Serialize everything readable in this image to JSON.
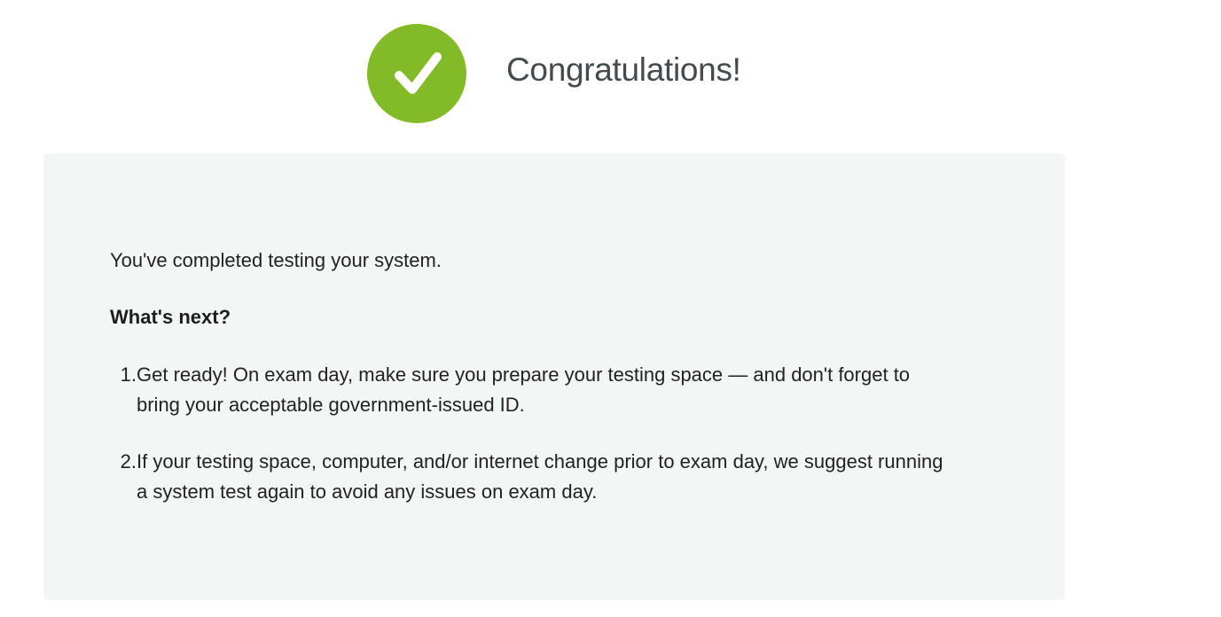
{
  "header": {
    "icon": "check-circle-icon",
    "accent_color": "#83ba28",
    "title": "Congratulations!"
  },
  "panel": {
    "background": "#f2f7f5",
    "intro": "You've completed testing your system.",
    "next_heading": "What's next?",
    "steps": [
      {
        "number": "1.",
        "text": "Get ready! On exam day, make sure you prepare your testing space — and don't forget to bring your acceptable government-issued ID."
      },
      {
        "number": "2.",
        "text": "If your testing space, computer, and/or internet change prior to exam day, we suggest running a system test again to avoid any issues on exam day."
      }
    ]
  }
}
